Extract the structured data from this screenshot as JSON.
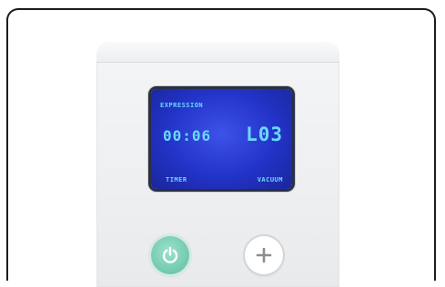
{
  "display": {
    "mode_label": "EXPRESSION",
    "timer_value": "00:06",
    "vacuum_level": "L03",
    "timer_label": "TIMER",
    "vacuum_label": "VACUUM"
  },
  "controls": {
    "power_icon": "power-icon",
    "plus_icon": "plus-icon"
  },
  "colors": {
    "lcd_background": "#2233c8",
    "lcd_text": "#6ad9ff",
    "power_button": "#6fc9ad"
  }
}
